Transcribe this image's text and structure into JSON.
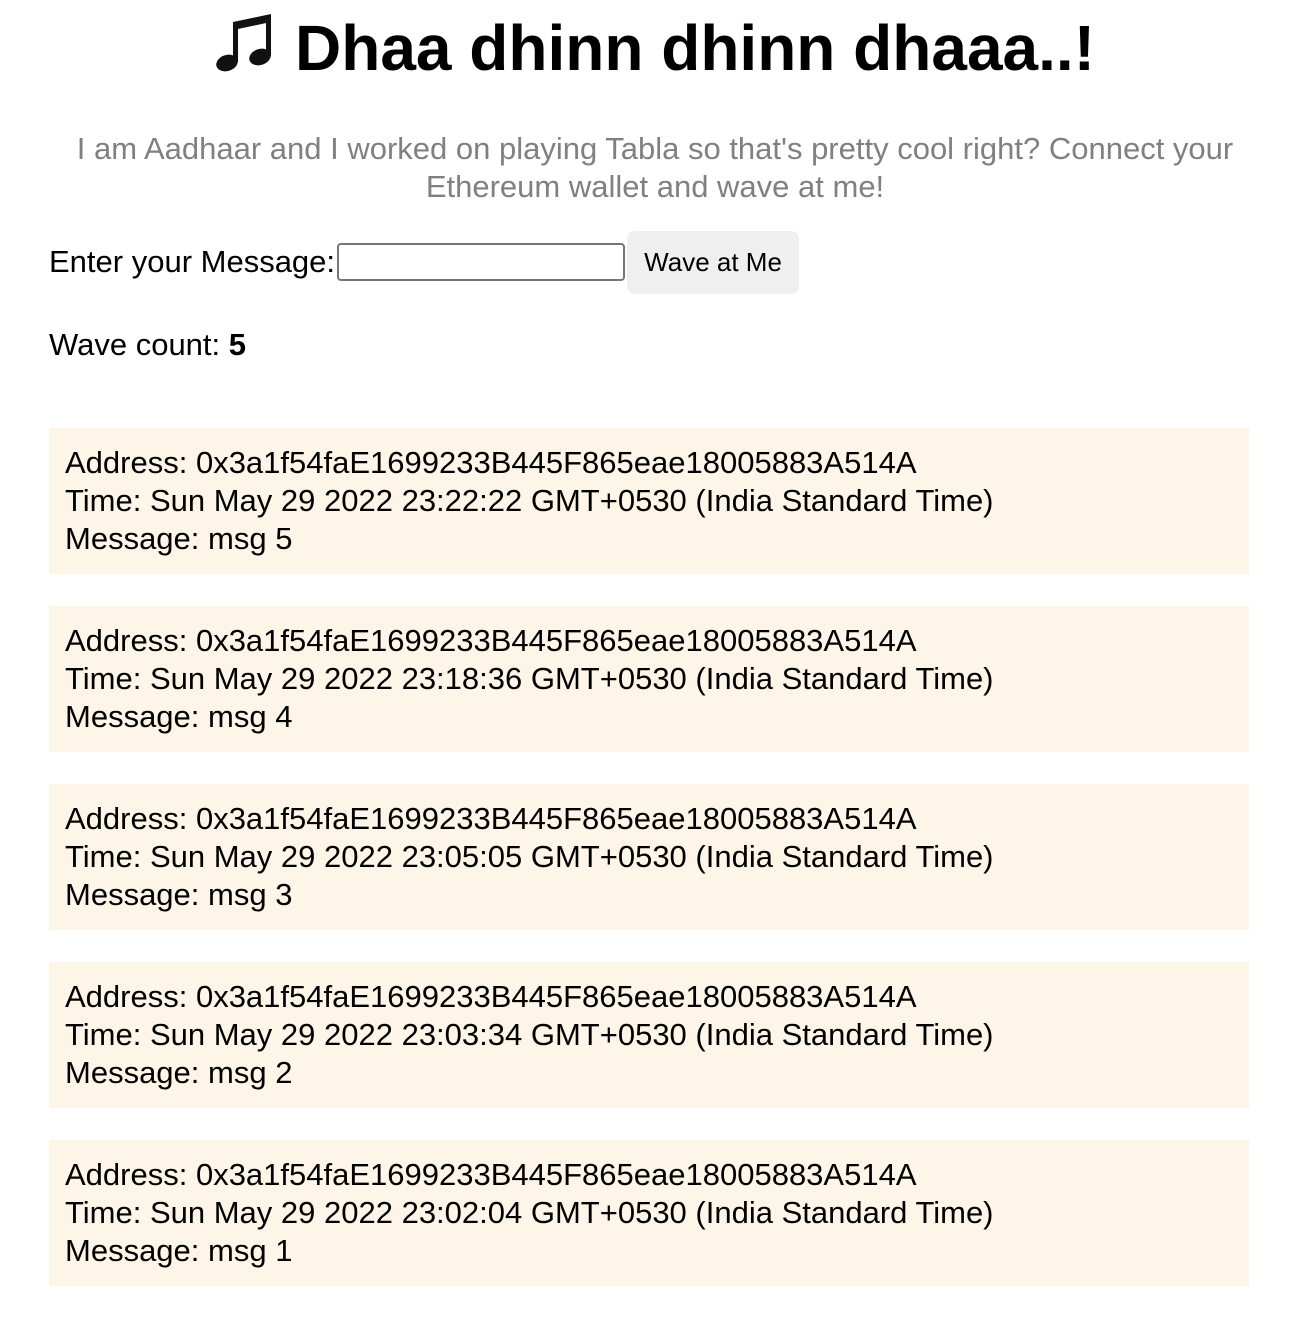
{
  "header": {
    "icon": "musical-notes-icon",
    "title": "Dhaa dhinn dhinn dhaaa..!"
  },
  "bio": "I am Aadhaar and I worked on playing Tabla so that's pretty cool right? Connect your Ethereum wallet and wave at me!",
  "form": {
    "label": "Enter your Message:",
    "input_value": "",
    "button_label": "Wave at Me"
  },
  "wave_count": {
    "label": "Wave count: ",
    "value": "5"
  },
  "waves": [
    {
      "address": "Address: 0x3a1f54faE1699233B445F865eae18005883A514A",
      "time": "Time: Sun May 29 2022 23:22:22 GMT+0530 (India Standard Time)",
      "message": "Message: msg 5"
    },
    {
      "address": "Address: 0x3a1f54faE1699233B445F865eae18005883A514A",
      "time": "Time: Sun May 29 2022 23:18:36 GMT+0530 (India Standard Time)",
      "message": "Message: msg 4"
    },
    {
      "address": "Address: 0x3a1f54faE1699233B445F865eae18005883A514A",
      "time": "Time: Sun May 29 2022 23:05:05 GMT+0530 (India Standard Time)",
      "message": "Message: msg 3"
    },
    {
      "address": "Address: 0x3a1f54faE1699233B445F865eae18005883A514A",
      "time": "Time: Sun May 29 2022 23:03:34 GMT+0530 (India Standard Time)",
      "message": "Message: msg 2"
    },
    {
      "address": "Address: 0x3a1f54faE1699233B445F865eae18005883A514A",
      "time": "Time: Sun May 29 2022 23:02:04 GMT+0530 (India Standard Time)",
      "message": "Message: msg 1"
    }
  ]
}
